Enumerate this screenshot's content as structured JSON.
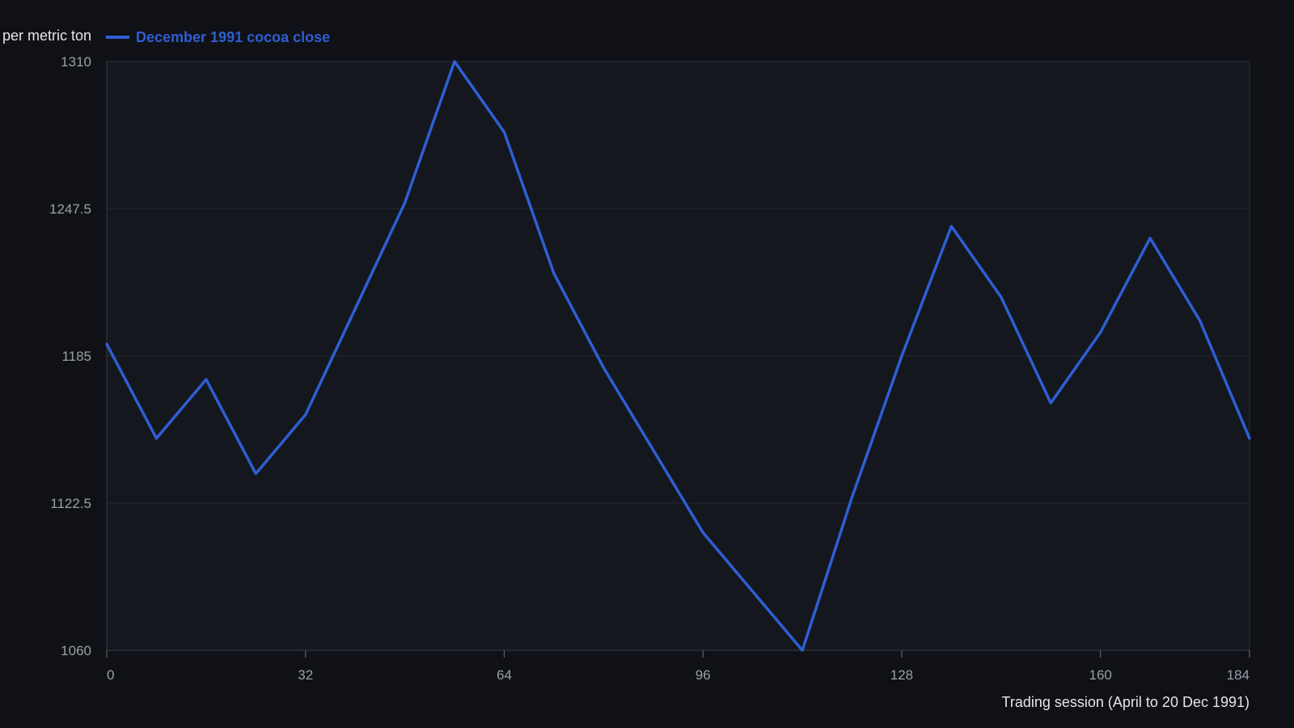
{
  "chart_data": {
    "type": "line",
    "title": "",
    "xlabel": "Trading session (April to 20 Dec 1991)",
    "ylabel": "per metric ton",
    "xlim": [
      0,
      184
    ],
    "ylim": [
      1060,
      1310
    ],
    "x_ticks": [
      0,
      32,
      64,
      96,
      128,
      160,
      184
    ],
    "y_ticks": [
      1060,
      1122.5,
      1185,
      1247.5,
      1310
    ],
    "grid": true,
    "legend_position": "top-left",
    "series": [
      {
        "name": "December 1991 cocoa close",
        "color": "#2f5ed4",
        "x": [
          0,
          8,
          16,
          24,
          32,
          40,
          48,
          56,
          64,
          72,
          80,
          88,
          96,
          104,
          112,
          120,
          128,
          136,
          144,
          152,
          160,
          168,
          176,
          184
        ],
        "y": [
          1190,
          1150,
          1175,
          1135,
          1160,
          1205,
          1250,
          1310,
          1280,
          1220,
          1180,
          1145,
          1110,
          1085,
          1060,
          1125,
          1185,
          1240,
          1210,
          1165,
          1195,
          1235,
          1200,
          1150
        ]
      }
    ]
  }
}
